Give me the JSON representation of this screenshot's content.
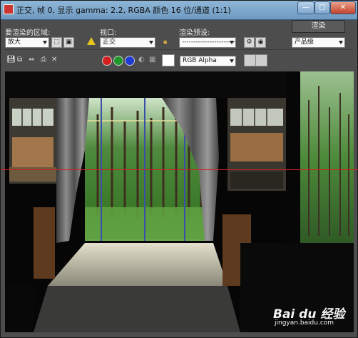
{
  "title_bar": {
    "title": "正交, 帧 0, 显示 gamma: 2.2, RGBA 颜色 16 位/通道 (1:1)"
  },
  "toolbar": {
    "area_label": "要渲染的区域:",
    "area_value": "放大",
    "viewport_label": "视口:",
    "viewport_value": "正交",
    "preset_label": "渲染预设:",
    "preset_value": "-------------------------",
    "render_button": "渲染",
    "quality_value": "产品级"
  },
  "channel_bar": {
    "display_channel": "RGB Alpha",
    "channel_colors": [
      "#d21f1f",
      "#1f9a2a",
      "#1f3ad2"
    ]
  },
  "watermark": {
    "logo": "Bai du 经验",
    "url": "jingyan.baidu.com"
  }
}
